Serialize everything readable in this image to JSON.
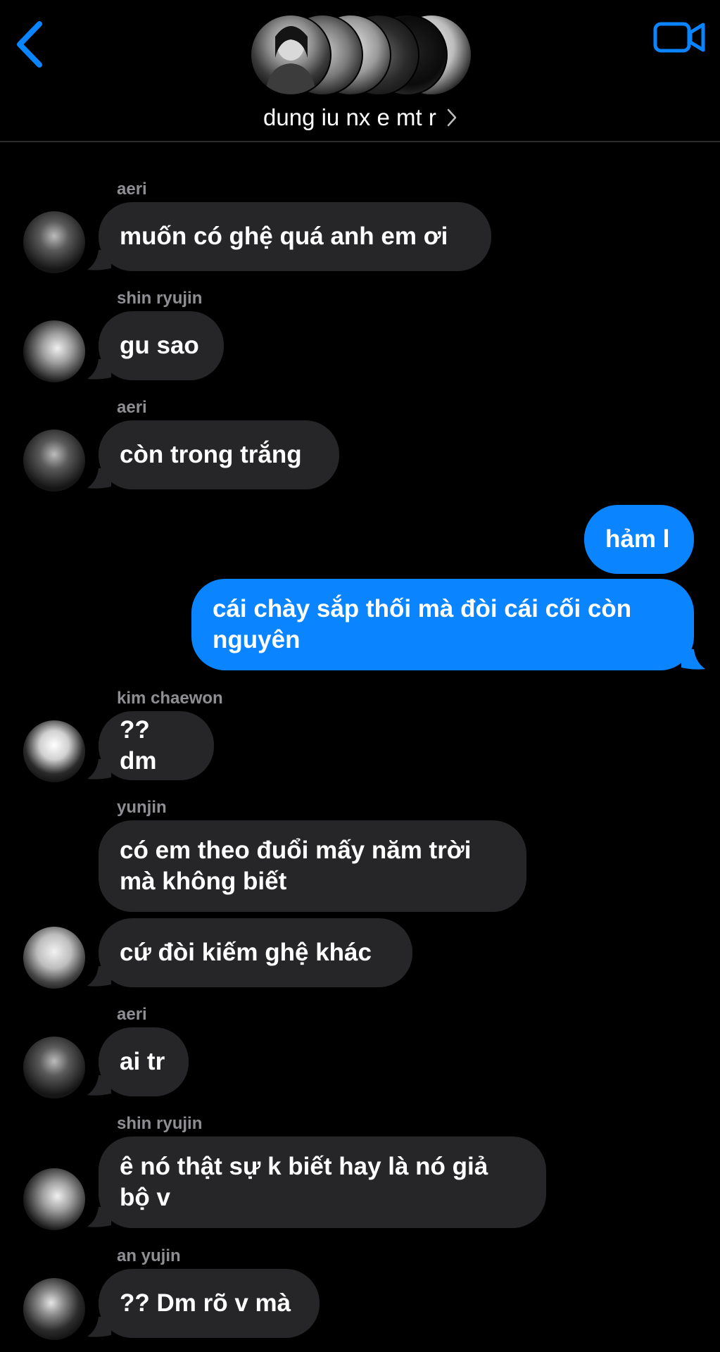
{
  "header": {
    "group_name": "dung iu nx e mt r",
    "back_icon": "chevron-left-icon",
    "video_icon": "video-camera-icon",
    "accent_color": "#0a84ff"
  },
  "messages": [
    {
      "sender": "aeri",
      "text": "muốn có ghệ quá anh em ơi",
      "direction": "incoming"
    },
    {
      "sender": "shin ryujin",
      "text": "gu sao",
      "direction": "incoming"
    },
    {
      "sender": "aeri",
      "text": "còn trong trắng",
      "direction": "incoming"
    },
    {
      "sender": "",
      "text": "hảm l",
      "direction": "outgoing"
    },
    {
      "sender": "",
      "text": "cái chày sắp thối mà đòi cái cối còn\nnguyên",
      "direction": "outgoing"
    },
    {
      "sender": "kim chaewon",
      "text": "?? dm",
      "direction": "incoming"
    },
    {
      "sender": "yunjin",
      "text": "có em theo đuổi mấy năm trời\nmà không biết",
      "direction": "incoming"
    },
    {
      "sender": "",
      "text": "cứ đòi kiếm ghệ khác",
      "direction": "incoming"
    },
    {
      "sender": "aeri",
      "text": "ai tr",
      "direction": "incoming"
    },
    {
      "sender": "shin ryujin",
      "text": "ê nó thật sự k biết hay là nó giả\nbộ v",
      "direction": "incoming"
    },
    {
      "sender": "an yujin",
      "text": "?? Dm rõ v mà",
      "direction": "incoming"
    }
  ],
  "colors": {
    "incoming_bubble": "#262628",
    "outgoing_bubble": "#0a84ff",
    "sender_name": "#8e8e93",
    "background": "#000000"
  }
}
